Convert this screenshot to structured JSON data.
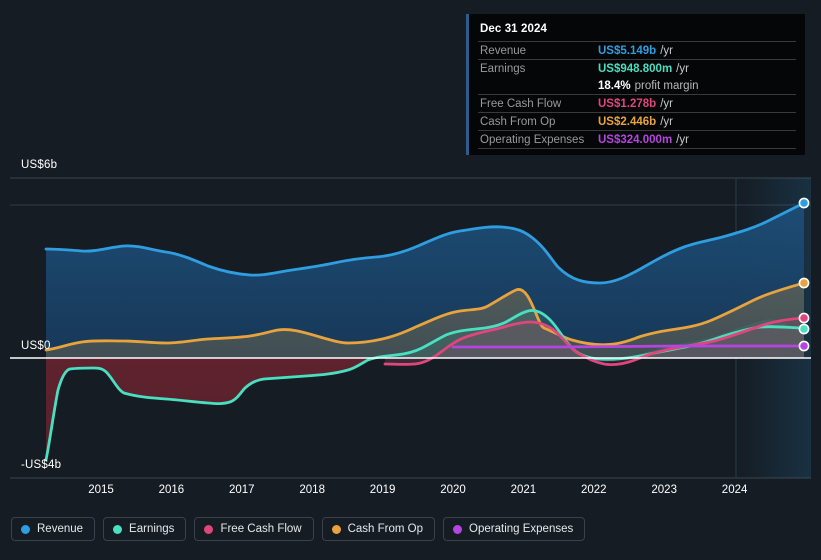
{
  "axes": {
    "y_labels": [
      "US$6b",
      "US$0",
      "-US$4b"
    ],
    "x_labels": [
      "2015",
      "2016",
      "2017",
      "2018",
      "2019",
      "2020",
      "2021",
      "2022",
      "2023",
      "2024"
    ]
  },
  "tooltip": {
    "date": "Dec 31 2024",
    "rows": [
      {
        "key": "Revenue",
        "value": "US$5.149b",
        "unit": "/yr",
        "color": "#2f9ee0"
      },
      {
        "key": "Earnings",
        "value": "US$948.800m",
        "unit": "/yr",
        "color": "#4adfc0"
      },
      {
        "key": "Free Cash Flow",
        "value": "US$1.278b",
        "unit": "/yr",
        "color": "#e0457b"
      },
      {
        "key": "Cash From Op",
        "value": "US$2.446b",
        "unit": "/yr",
        "color": "#e8a33d"
      },
      {
        "key": "Operating Expenses",
        "value": "US$324.000m",
        "unit": "/yr",
        "color": "#b545e0"
      }
    ],
    "margin_value": "18.4%",
    "margin_label": "profit margin"
  },
  "legend": [
    {
      "label": "Revenue",
      "color": "#2f9ee0"
    },
    {
      "label": "Earnings",
      "color": "#4adfc0"
    },
    {
      "label": "Free Cash Flow",
      "color": "#e0457b"
    },
    {
      "label": "Cash From Op",
      "color": "#e8a33d"
    },
    {
      "label": "Operating Expenses",
      "color": "#b545e0"
    }
  ],
  "chart_data": {
    "type": "area",
    "title": "",
    "xlabel": "",
    "ylabel": "",
    "ylim": [
      -4,
      6
    ],
    "yticks": [
      6,
      0,
      -4
    ],
    "grid": true,
    "legend_position": "bottom",
    "x": [
      "2014.3",
      "2015",
      "2016",
      "2017",
      "2018",
      "2019",
      "2020",
      "2021",
      "2022",
      "2023",
      "2024",
      "2024.9"
    ],
    "units": "US$ billions per year",
    "series": [
      {
        "name": "Revenue",
        "color": "#2f9ee0",
        "values": [
          3.62,
          3.6,
          3.38,
          3.25,
          3.46,
          3.38,
          3.72,
          4.2,
          3.4,
          3.95,
          4.72,
          5.149
        ]
      },
      {
        "name": "Earnings",
        "color": "#4adfc0",
        "values": [
          -3.8,
          -1.05,
          -2.0,
          -0.5,
          0.05,
          0.1,
          1.1,
          1.4,
          -0.1,
          0.25,
          0.7,
          0.9488
        ]
      },
      {
        "name": "Free Cash Flow",
        "color": "#e0457b",
        "values": [
          null,
          null,
          null,
          null,
          null,
          -0.22,
          0.55,
          1.02,
          -0.05,
          0.3,
          0.8,
          1.278
        ]
      },
      {
        "name": "Cash From Op",
        "color": "#e8a33d",
        "values": [
          0.28,
          0.46,
          0.42,
          0.46,
          0.6,
          0.5,
          1.12,
          1.5,
          0.62,
          1.05,
          1.65,
          2.446
        ]
      },
      {
        "name": "Operating Expenses",
        "color": "#b545e0",
        "values": [
          null,
          null,
          null,
          null,
          null,
          null,
          0.3,
          0.3,
          0.31,
          0.32,
          0.32,
          0.324
        ]
      }
    ]
  }
}
